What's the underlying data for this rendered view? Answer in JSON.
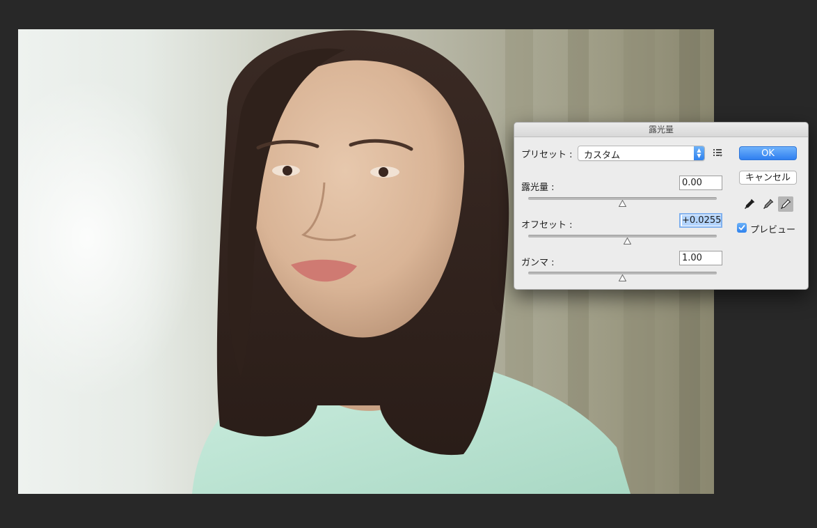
{
  "dialog": {
    "title": "露光量",
    "preset": {
      "label": "プリセット :",
      "value": "カスタム",
      "menu_icon": "preset-options-icon"
    },
    "exposure": {
      "label": "露光量 :",
      "value": "0.00",
      "slider_level": 0.5
    },
    "offset": {
      "label": "オフセット :",
      "value": "+0.0255",
      "slider_level": 0.525
    },
    "gamma": {
      "label": "ガンマ :",
      "value": "1.00",
      "slider_level": 0.5
    },
    "buttons": {
      "ok": "OK",
      "cancel": "キャンセル"
    },
    "eyedroppers": [
      "black-point-eyedropper-icon",
      "gray-point-eyedropper-icon",
      "white-point-eyedropper-icon"
    ],
    "preview": {
      "label": "プレビュー",
      "checked": true
    }
  },
  "colors": {
    "workspace_background": "#282828",
    "accent_blue": "#2f82ee",
    "dialog_background": "#ececec"
  }
}
